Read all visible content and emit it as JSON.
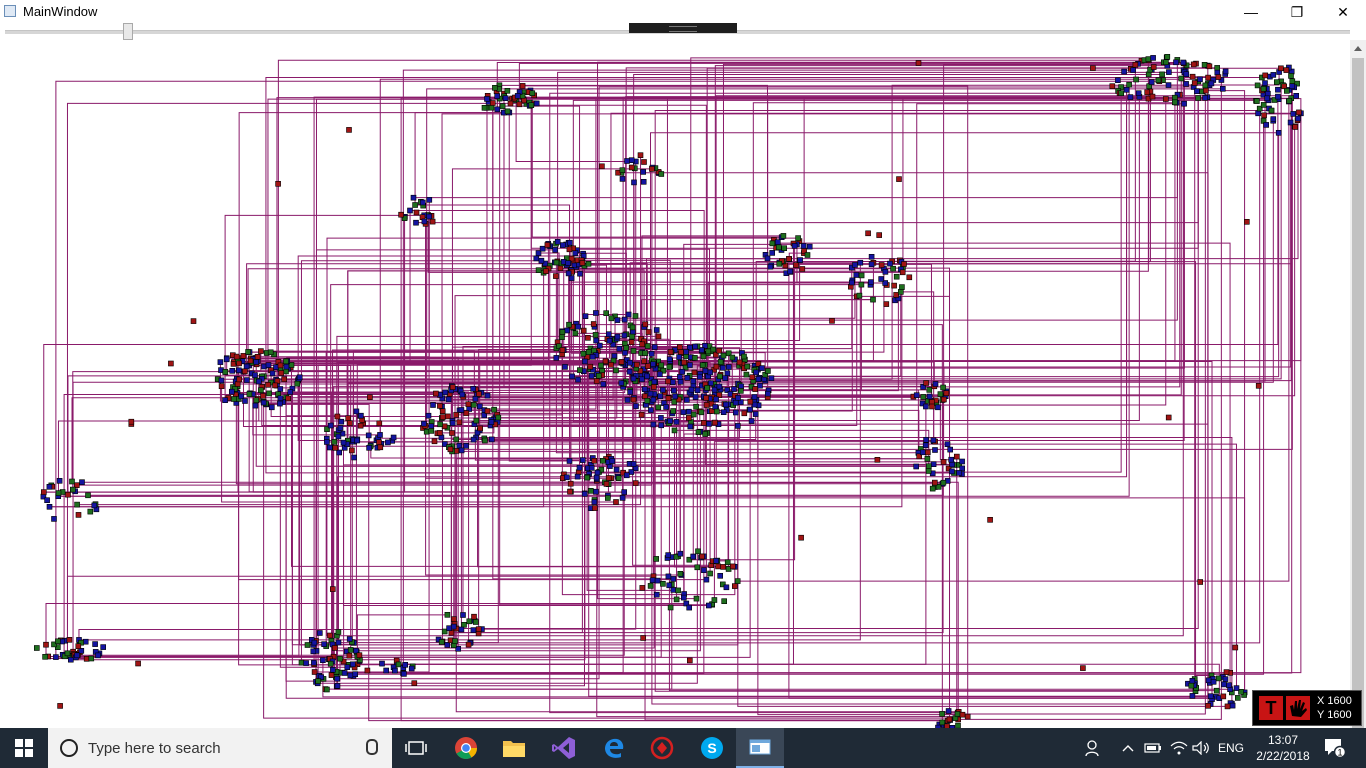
{
  "window": {
    "title": "MainWindow",
    "minimize_glyph": "—",
    "maximize_glyph": "❐",
    "close_glyph": "✕"
  },
  "zoom_slider": {
    "value_fraction": 0.09
  },
  "canvas": {
    "node_color_blue": "#1414a0",
    "node_color_green": "#1e6e1e",
    "node_color_red": "#a01414",
    "edge_color": "#8a1a6a"
  },
  "coord_readout": {
    "x_text": "X 1600",
    "y_text": "Y 1600"
  },
  "taskbar": {
    "search_placeholder": "Type here to search",
    "language": "ENG",
    "time": "13:07",
    "date": "2/22/2018",
    "notification_count": "1",
    "apps": [
      "task-view",
      "chrome",
      "file-explorer",
      "visual-studio",
      "edge",
      "app-red",
      "skype",
      "app-window"
    ]
  }
}
